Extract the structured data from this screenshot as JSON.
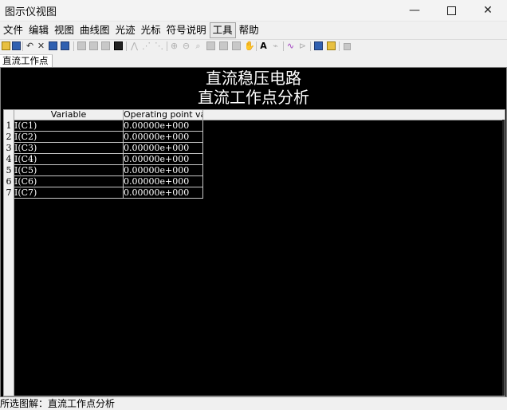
{
  "window": {
    "title": "图示仪视图",
    "minimize_glyph": "—",
    "close_glyph": "✕"
  },
  "menu": {
    "items": [
      "文件",
      "编辑",
      "视图",
      "曲线图",
      "光迹",
      "光标",
      "符号说明",
      "工具",
      "帮助"
    ],
    "active_index": 7
  },
  "toolbar": {
    "icons": [
      "open-folder-icon",
      "save-icon",
      "undo-icon",
      "delete-icon",
      "copy-icon",
      "paste-icon",
      "grid-icon",
      "background-icon",
      "select-icon",
      "display-icon",
      "cursor-icon",
      "cursor-next-icon",
      "cursor-prev-icon",
      "zoom-in-icon",
      "zoom-out-icon",
      "zoom-area-icon",
      "zoom-full-icon",
      "zoom-x-icon",
      "zoom-y-icon",
      "pan-icon",
      "text-icon",
      "label-icon",
      "trace-properties-icon",
      "marker-icon",
      "copy-graph-icon",
      "paste-graph-icon",
      "stop-icon"
    ],
    "glyph_text": "A"
  },
  "tabs": {
    "active_label": "直流工作点"
  },
  "graph": {
    "title_line1": "直流稳压电路",
    "title_line2": "直流工作点分析",
    "columns": [
      "Variable",
      "Operating point value"
    ],
    "rows": [
      {
        "num": "1",
        "variable": "I(C1)",
        "value": "0.00000e+000"
      },
      {
        "num": "2",
        "variable": "I(C2)",
        "value": "0.00000e+000"
      },
      {
        "num": "3",
        "variable": "I(C3)",
        "value": "0.00000e+000"
      },
      {
        "num": "4",
        "variable": "I(C4)",
        "value": "0.00000e+000"
      },
      {
        "num": "5",
        "variable": "I(C5)",
        "value": "0.00000e+000"
      },
      {
        "num": "6",
        "variable": "I(C6)",
        "value": "0.00000e+000"
      },
      {
        "num": "7",
        "variable": "I(C7)",
        "value": "0.00000e+000"
      }
    ]
  },
  "status": {
    "text": "所选图解：直流工作点分析"
  }
}
